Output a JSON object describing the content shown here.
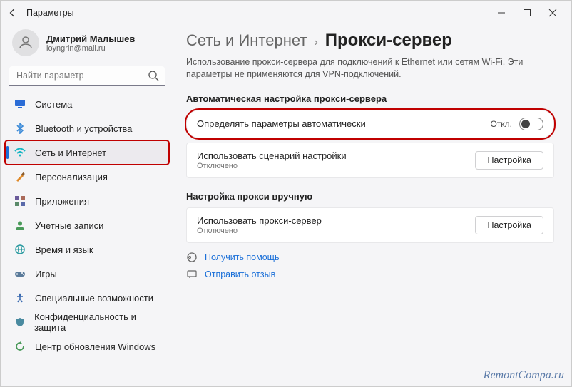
{
  "window": {
    "title": "Параметры"
  },
  "profile": {
    "name": "Дмитрий Малышев",
    "email": "loyngrin@mail.ru"
  },
  "search": {
    "placeholder": "Найти параметр"
  },
  "sidebar": {
    "items": [
      {
        "label": "Система",
        "icon": "system-icon",
        "color": "#2b6cd6"
      },
      {
        "label": "Bluetooth и устройства",
        "icon": "bluetooth-icon",
        "color": "#3b8ad8"
      },
      {
        "label": "Сеть и Интернет",
        "icon": "wifi-icon",
        "color": "#18b6c4",
        "active": true
      },
      {
        "label": "Персонализация",
        "icon": "brush-icon",
        "color": "#e08a2a"
      },
      {
        "label": "Приложения",
        "icon": "apps-icon",
        "color": "#6a5a9a"
      },
      {
        "label": "Учетные записи",
        "icon": "account-icon",
        "color": "#4a9a5a"
      },
      {
        "label": "Время и язык",
        "icon": "globe-icon",
        "color": "#2a9aa0"
      },
      {
        "label": "Игры",
        "icon": "games-icon",
        "color": "#5a7a9a"
      },
      {
        "label": "Специальные возможности",
        "icon": "accessibility-icon",
        "color": "#3a6ab0"
      },
      {
        "label": "Конфиденциальность и защита",
        "icon": "shield-icon",
        "color": "#4a8aa0"
      },
      {
        "label": "Центр обновления Windows",
        "icon": "update-icon",
        "color": "#4a9a5a"
      }
    ]
  },
  "breadcrumb": {
    "parent": "Сеть и Интернет",
    "current": "Прокси-сервер"
  },
  "description": "Использование прокси-сервера для подключений к Ethernet или сетям Wi-Fi. Эти параметры не применяются для VPN-подключений.",
  "sections": {
    "auto": {
      "title": "Автоматическая настройка прокси-сервера",
      "detect": {
        "label": "Определять параметры автоматически",
        "state": "Откл."
      },
      "script": {
        "label": "Использовать сценарий настройки",
        "sub": "Отключено",
        "button": "Настройка"
      }
    },
    "manual": {
      "title": "Настройка прокси вручную",
      "use": {
        "label": "Использовать прокси-сервер",
        "sub": "Отключено",
        "button": "Настройка"
      }
    }
  },
  "help": {
    "get": "Получить помощь",
    "feedback": "Отправить отзыв"
  },
  "watermark": "RemontCompa.ru"
}
